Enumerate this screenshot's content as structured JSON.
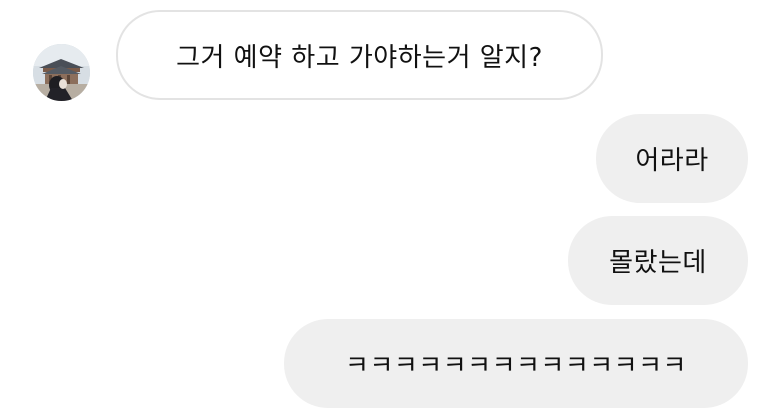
{
  "conversation": {
    "avatar_icon": "profile-photo-palace-avatar",
    "incoming": [
      {
        "text": "그거 예약 하고 가야하는거 알지?"
      }
    ],
    "outgoing": [
      {
        "text": "어라라"
      },
      {
        "text": "몰랐는데"
      },
      {
        "text": "ㅋㅋㅋㅋㅋㅋㅋㅋㅋㅋㅋㅋㅋㅋ"
      }
    ]
  },
  "colors": {
    "incoming_bg": "#ffffff",
    "incoming_border": "#e3e3e3",
    "outgoing_bg": "#efefef",
    "text": "#111111"
  }
}
